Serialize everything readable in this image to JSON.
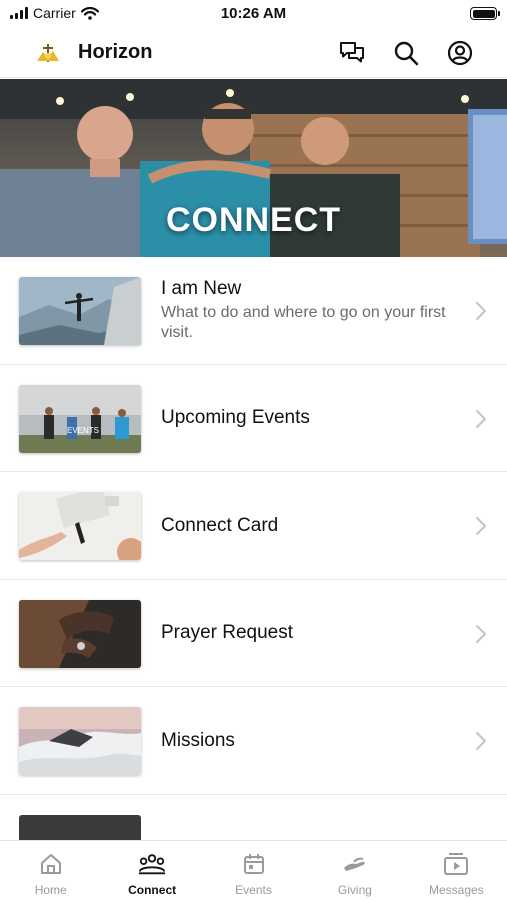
{
  "status_bar": {
    "carrier": "Carrier",
    "time": "10:26 AM"
  },
  "header": {
    "title": "Horizon",
    "icons": [
      "logo-icon",
      "chat-icon",
      "search-icon",
      "profile-icon"
    ]
  },
  "hero": {
    "label": "CONNECT"
  },
  "list": {
    "items": [
      {
        "title": "I am New",
        "subtitle": "What to do and where to go on your first visit.",
        "thumb": "mountain-person"
      },
      {
        "title": "Upcoming Events",
        "subtitle": "",
        "thumb": "events-field",
        "thumb_text": "EVENTS"
      },
      {
        "title": "Connect Card",
        "subtitle": "",
        "thumb": "keyboard-hands"
      },
      {
        "title": "Prayer Request",
        "subtitle": "",
        "thumb": "praying-hands"
      },
      {
        "title": "Missions",
        "subtitle": "",
        "thumb": "clouds"
      }
    ]
  },
  "tabs": [
    {
      "label": "Home",
      "icon": "home-icon",
      "active": false
    },
    {
      "label": "Connect",
      "icon": "people-icon",
      "active": true
    },
    {
      "label": "Events",
      "icon": "calendar-icon",
      "active": false
    },
    {
      "label": "Giving",
      "icon": "giving-hand-icon",
      "active": false
    },
    {
      "label": "Messages",
      "icon": "play-video-icon",
      "active": false
    }
  ],
  "colors": {
    "active_tab": "#111111",
    "inactive_tab": "#9a9a9a",
    "logo_gold": "#e8b72a"
  }
}
